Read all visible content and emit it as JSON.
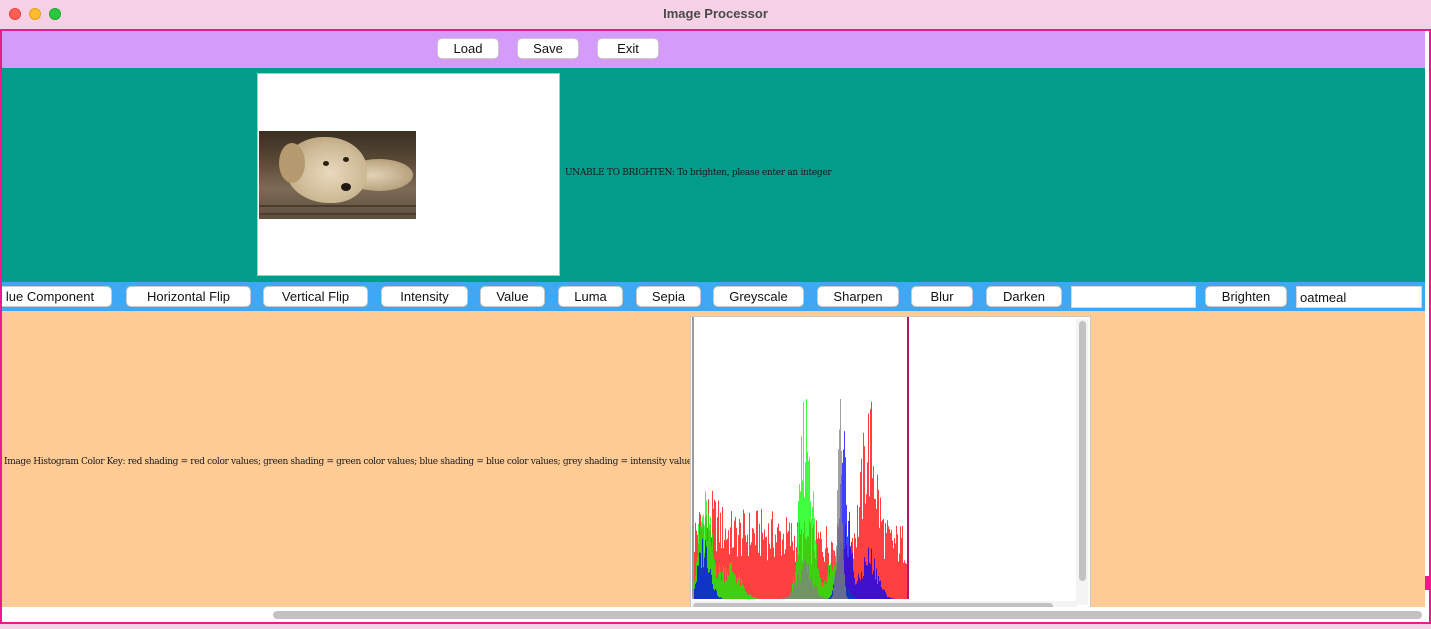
{
  "window": {
    "title": "Image Processor"
  },
  "toolbar": {
    "load_label": "Load",
    "save_label": "Save",
    "exit_label": "Exit"
  },
  "image_panel": {
    "status_message": "UNABLE TO BRIGHTEN: To brighten, please enter an integer"
  },
  "operations": {
    "buttons": [
      "lue Component",
      "Horizontal Flip",
      "Vertical Flip",
      "Intensity",
      "Value",
      "Luma",
      "Sepia",
      "Greyscale",
      "Sharpen",
      "Blur",
      "Darken"
    ],
    "darken_amount_value": "",
    "brighten_label": "Brighten",
    "brighten_amount_value": "oatmeal"
  },
  "histogram_panel": {
    "color_key": "Image Histogram Color Key: red shading = red color values; green shading = green color values; blue shading = blue color values; grey shading = intensity values",
    "colors": {
      "red": "#ff0000",
      "green": "#00ff00",
      "blue": "#0000ff",
      "grey": "#808080"
    }
  },
  "colors": {
    "title_bar": "#f6d0e4",
    "frame_border": "#ee1a8c",
    "toolbar_bg": "#d59bfb",
    "image_panel_bg": "#039b89",
    "operations_bg": "#3fa8f4",
    "histogram_panel_bg": "#ffcb95"
  }
}
